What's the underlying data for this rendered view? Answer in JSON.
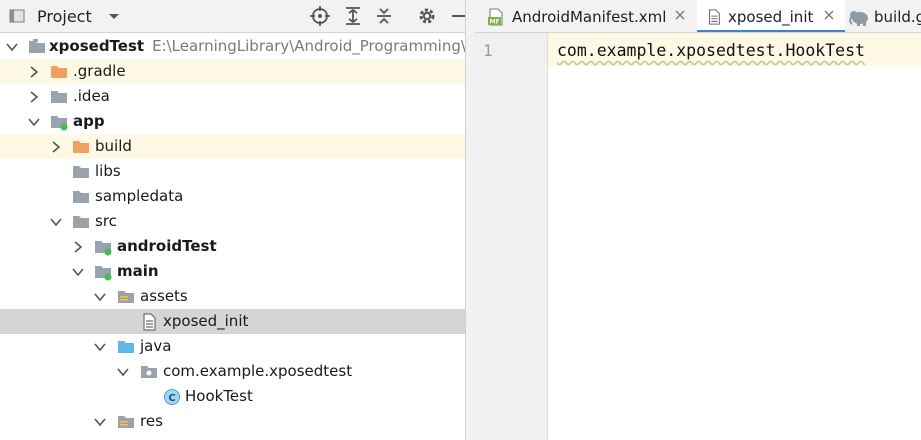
{
  "project_panel": {
    "title": "Project",
    "tree": [
      {
        "label": "xposedTest",
        "path": "E:\\LearningLibrary\\Android_Programming\\xpo",
        "bold": true
      },
      {
        "label": ".gradle"
      },
      {
        "label": ".idea"
      },
      {
        "label": "app",
        "bold": true
      },
      {
        "label": "build"
      },
      {
        "label": "libs"
      },
      {
        "label": "sampledata"
      },
      {
        "label": "src"
      },
      {
        "label": "androidTest",
        "bold": true
      },
      {
        "label": "main",
        "bold": true
      },
      {
        "label": "assets"
      },
      {
        "label": "xposed_init"
      },
      {
        "label": "java"
      },
      {
        "label": "com.example.xposedtest"
      },
      {
        "label": "HookTest"
      },
      {
        "label": "res"
      }
    ]
  },
  "editor": {
    "tabs": [
      {
        "label": "AndroidManifest.xml",
        "icon_text": "MF"
      },
      {
        "label": "xposed_init"
      },
      {
        "label": "build.g"
      }
    ],
    "line_number": "1",
    "code": "com.example.xposedtest.HookTest",
    "class_icon_letter": "C"
  },
  "colors": {
    "selection": "#d5d5d5",
    "highlight": "#fdf9e5",
    "folder_orange": "#f2a062",
    "folder_blue": "#65b6e8",
    "folder_gray": "#9aa2ab",
    "module_dot": "#3fbf4f",
    "tab_underline": "#4083c9"
  }
}
